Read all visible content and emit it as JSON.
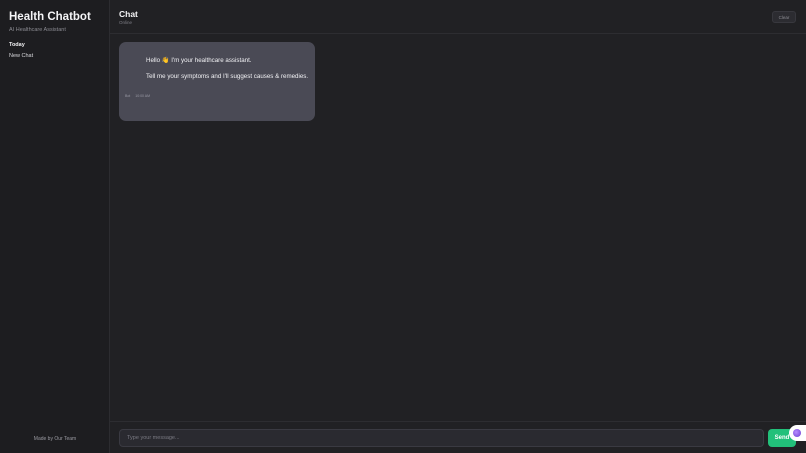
{
  "sidebar": {
    "title": "Health Chatbot",
    "subtitle": "AI Healthcare Assistant",
    "section": "Today",
    "items": [
      {
        "label": "New Chat"
      }
    ],
    "footer": "Made by Our Team"
  },
  "header": {
    "title": "Chat",
    "status": "Online",
    "clear_label": "Clear"
  },
  "messages": [
    {
      "line1": "Hello 👋 I'm your healthcare assistant.",
      "line2": "Tell me your symptoms and I'll suggest causes & remedies.",
      "sender": "Bot",
      "time": "10:00 AM"
    }
  ],
  "composer": {
    "placeholder": "Type your message...",
    "send_label": "Send"
  },
  "colors": {
    "background": "#212124",
    "bubble": "#4a4a55",
    "accent": "#22c07a"
  },
  "icons": {
    "widget": "assistant-orb-icon"
  }
}
